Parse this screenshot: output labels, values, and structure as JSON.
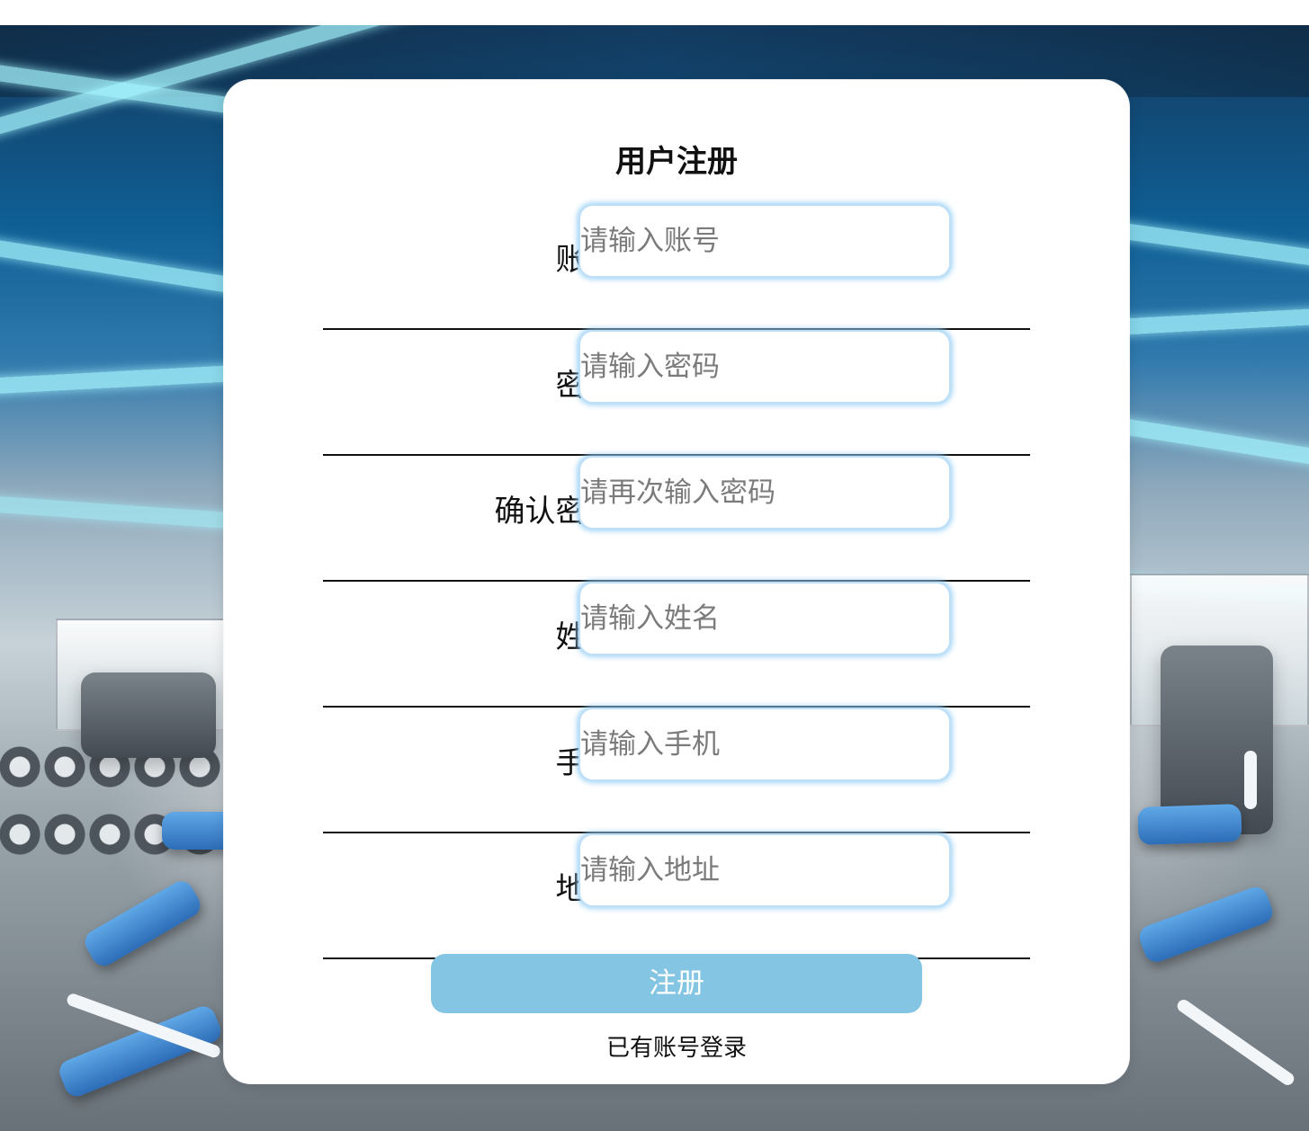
{
  "form": {
    "title": "用户注册",
    "fields": [
      {
        "label": "账号:",
        "placeholder": "请输入账号",
        "value": ""
      },
      {
        "label": "密码:",
        "placeholder": "请输入密码",
        "value": ""
      },
      {
        "label": "确认密码:",
        "placeholder": "请再次输入密码",
        "value": ""
      },
      {
        "label": "姓名:",
        "placeholder": "请输入姓名",
        "value": ""
      },
      {
        "label": "手机:",
        "placeholder": "请输入手机",
        "value": ""
      },
      {
        "label": "地址:",
        "placeholder": "请输入地址",
        "value": ""
      }
    ],
    "submit_label": "注册",
    "login_link": "已有账号登录"
  },
  "colors": {
    "card_background": "#ffffff",
    "button_background": "#85c5e4",
    "input_border": "#bddff7",
    "text": "#111111",
    "placeholder": "#7b7b7b"
  },
  "background": {
    "scene": "gym interior"
  }
}
